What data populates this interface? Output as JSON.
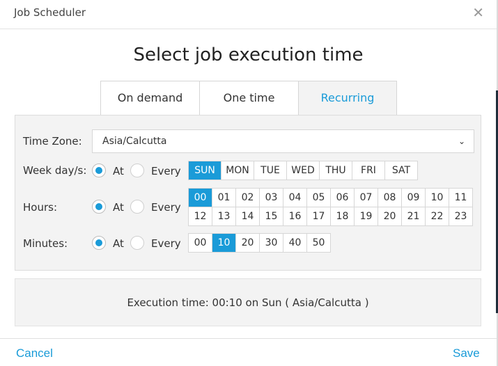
{
  "window": {
    "title": "Job Scheduler"
  },
  "heading": "Select job execution time",
  "tabs": [
    {
      "label": "On demand",
      "active": false
    },
    {
      "label": "One time",
      "active": false
    },
    {
      "label": "Recurring",
      "active": true
    }
  ],
  "timezone": {
    "label": "Time Zone:",
    "value": "Asia/Calcutta"
  },
  "weekdays": {
    "label": "Week day/s:",
    "mode_at": "At",
    "mode_every": "Every",
    "selected_mode": "At",
    "options": [
      "SUN",
      "MON",
      "TUE",
      "WED",
      "THU",
      "FRI",
      "SAT"
    ],
    "selected": [
      "SUN"
    ]
  },
  "hours": {
    "label": "Hours:",
    "mode_at": "At",
    "mode_every": "Every",
    "selected_mode": "At",
    "options": [
      "00",
      "01",
      "02",
      "03",
      "04",
      "05",
      "06",
      "07",
      "08",
      "09",
      "10",
      "11",
      "12",
      "13",
      "14",
      "15",
      "16",
      "17",
      "18",
      "19",
      "20",
      "21",
      "22",
      "23"
    ],
    "selected": [
      "00"
    ]
  },
  "minutes": {
    "label": "Minutes:",
    "mode_at": "At",
    "mode_every": "Every",
    "selected_mode": "At",
    "options": [
      "00",
      "10",
      "20",
      "30",
      "40",
      "50"
    ],
    "selected": [
      "10"
    ]
  },
  "execution_text": "Execution time: 00:10 on Sun ( Asia/Calcutta )",
  "footer": {
    "cancel_label": "Cancel",
    "save_label": "Save"
  },
  "colors": {
    "accent": "#1a9bd8",
    "panel": "#f3f3f3",
    "border": "#d6d6d6"
  }
}
